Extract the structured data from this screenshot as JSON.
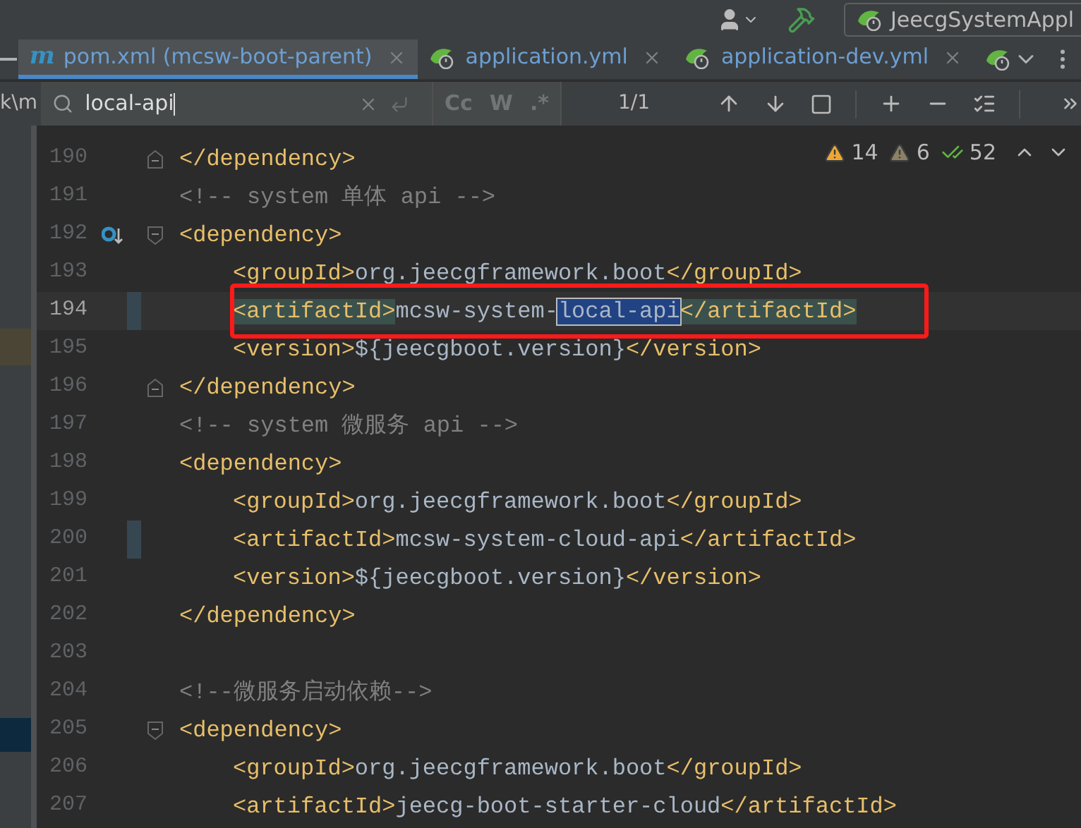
{
  "toolbar": {
    "run_config": "JeecgSystemAppl"
  },
  "project_panel": {
    "path_fragment": "k\\m"
  },
  "tabs": [
    {
      "label": "pom.xml (mcsw-boot-parent)",
      "badge": "m",
      "kind": "maven",
      "selected": true
    },
    {
      "label": "application.yml",
      "kind": "spring",
      "selected": false
    },
    {
      "label": "application-dev.yml",
      "kind": "spring",
      "selected": false
    }
  ],
  "search": {
    "value": "local-api",
    "toggles": [
      {
        "label": "Cc",
        "on": false
      },
      {
        "label": "W",
        "on": false
      },
      {
        "label": ".*",
        "on": false
      }
    ],
    "count": "1/1"
  },
  "inspections": {
    "warnings": "14",
    "weak_warnings": "6",
    "typos": "52"
  },
  "lines": [
    {
      "number": "190",
      "fold_close": true,
      "segments": [
        {
          "kind": "tag",
          "text": "</dependency>"
        }
      ]
    },
    {
      "number": "191",
      "segments": [
        {
          "kind": "comment",
          "text": "<!-- system 单体 api -->"
        }
      ]
    },
    {
      "number": "192",
      "fold_open": true,
      "gutter_icon": true,
      "segments": [
        {
          "kind": "tag",
          "text": "<dependency>"
        }
      ]
    },
    {
      "number": "193",
      "indented": true,
      "segments": [
        {
          "kind": "tag",
          "text": "<groupId>"
        },
        {
          "kind": "text",
          "text": "org.jeecgframework.boot"
        },
        {
          "kind": "tag",
          "text": "</groupId>"
        }
      ]
    },
    {
      "number": "194",
      "indented": true,
      "current": true,
      "changed": true,
      "boxed": true,
      "segments": [
        {
          "kind": "tag-match",
          "text": "<artifactId>"
        },
        {
          "kind": "text",
          "text": "mcsw-system-"
        },
        {
          "kind": "search-hit",
          "text": "local-api"
        },
        {
          "kind": "tag-match",
          "text": "</artifactId>"
        }
      ]
    },
    {
      "number": "195",
      "indented": true,
      "segments": [
        {
          "kind": "tag",
          "text": "<version>"
        },
        {
          "kind": "text",
          "text": "${jeecgboot.version}"
        },
        {
          "kind": "tag",
          "text": "</version>"
        }
      ]
    },
    {
      "number": "196",
      "fold_close": true,
      "segments": [
        {
          "kind": "tag",
          "text": "</dependency>"
        }
      ]
    },
    {
      "number": "197",
      "segments": [
        {
          "kind": "comment",
          "text": "<!-- system 微服务 api -->"
        }
      ]
    },
    {
      "number": "198",
      "segments": [
        {
          "kind": "tag",
          "text": "<dependency>"
        }
      ]
    },
    {
      "number": "199",
      "indented": true,
      "segments": [
        {
          "kind": "tag",
          "text": "<groupId>"
        },
        {
          "kind": "text",
          "text": "org.jeecgframework.boot"
        },
        {
          "kind": "tag",
          "text": "</groupId>"
        }
      ]
    },
    {
      "number": "200",
      "indented": true,
      "changed": true,
      "segments": [
        {
          "kind": "tag",
          "text": "<artifactId>"
        },
        {
          "kind": "text",
          "text": "mcsw-system-cloud-api"
        },
        {
          "kind": "tag",
          "text": "</artifactId>"
        }
      ]
    },
    {
      "number": "201",
      "indented": true,
      "segments": [
        {
          "kind": "tag",
          "text": "<version>"
        },
        {
          "kind": "text",
          "text": "${jeecgboot.version}"
        },
        {
          "kind": "tag",
          "text": "</version>"
        }
      ]
    },
    {
      "number": "202",
      "segments": [
        {
          "kind": "tag",
          "text": "</dependency>"
        }
      ]
    },
    {
      "number": "203"
    },
    {
      "number": "204",
      "segments": [
        {
          "kind": "comment",
          "text": "<!--微服务启动依赖-->"
        }
      ]
    },
    {
      "number": "205",
      "fold_open": true,
      "segments": [
        {
          "kind": "tag",
          "text": "<dependency>"
        }
      ]
    },
    {
      "number": "206",
      "indented": true,
      "segments": [
        {
          "kind": "tag",
          "text": "<groupId>"
        },
        {
          "kind": "text",
          "text": "org.jeecgframework.boot"
        },
        {
          "kind": "tag",
          "text": "</groupId>"
        }
      ]
    },
    {
      "number": "207",
      "indented": true,
      "segments": [
        {
          "kind": "tag",
          "text": "<artifactId>"
        },
        {
          "kind": "text",
          "text": "jeecg-boot-starter-cloud"
        },
        {
          "kind": "tag",
          "text": "</artifactId>"
        }
      ]
    }
  ]
}
